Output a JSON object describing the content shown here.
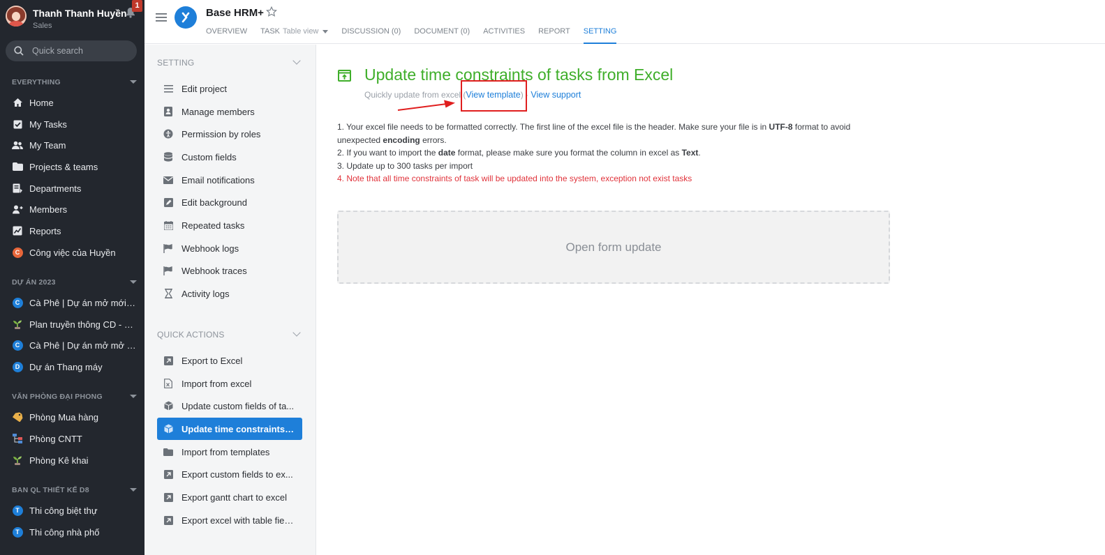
{
  "user": {
    "name": "Thanh Thanh Huyền",
    "role": "Sales",
    "notification_count": "1"
  },
  "search": {
    "placeholder": "Quick search"
  },
  "sidebar": {
    "groups": [
      {
        "title": "EVERYTHING",
        "items": [
          {
            "label": "Home",
            "icon": "home-icon"
          },
          {
            "label": "My Tasks",
            "icon": "task-check-icon"
          },
          {
            "label": "My Team",
            "icon": "team-icon"
          },
          {
            "label": "Projects & teams",
            "icon": "folder-icon"
          },
          {
            "label": "Departments",
            "icon": "departments-icon"
          },
          {
            "label": "Members",
            "icon": "members-icon"
          },
          {
            "label": "Reports",
            "icon": "reports-chart-icon"
          },
          {
            "label": "Công việc của Huyền",
            "badge": "C",
            "color": "#e8663a"
          }
        ]
      },
      {
        "title": "DỰ ÁN 2023",
        "items": [
          {
            "label": "Cà Phê | Dự án mở mới c...",
            "badge": "C",
            "color": "#1e7fd9"
          },
          {
            "label": "Plan truyền thông CD - M...",
            "icon": "plant-icon"
          },
          {
            "label": "Cà Phê | Dự án mở mở V...",
            "badge": "C",
            "color": "#1e7fd9"
          },
          {
            "label": "Dự án Thang máy",
            "badge": "D",
            "color": "#1e7fd9"
          }
        ]
      },
      {
        "title": "VĂN PHÒNG ĐẠI PHONG",
        "items": [
          {
            "label": "Phòng Mua hàng",
            "icon": "tag-icon"
          },
          {
            "label": "Phòng CNTT",
            "icon": "hierarchy-icon"
          },
          {
            "label": "Phòng Kê khai",
            "icon": "plant-icon"
          }
        ]
      },
      {
        "title": "BAN QL THIẾT KẾ D8",
        "items": [
          {
            "label": "Thi công biệt thự",
            "badge": "T",
            "color": "#1e7fd9"
          },
          {
            "label": "Thi công nhà phố",
            "badge": "T",
            "color": "#1e7fd9"
          }
        ]
      }
    ]
  },
  "header": {
    "project_title": "Base HRM+",
    "tabs": [
      {
        "label": "OVERVIEW"
      },
      {
        "label": "TASK",
        "sub": "Table view"
      },
      {
        "label": "DISCUSSION (0)"
      },
      {
        "label": "DOCUMENT (0)"
      },
      {
        "label": "ACTIVITIES"
      },
      {
        "label": "REPORT"
      },
      {
        "label": "SETTING",
        "active": true
      }
    ]
  },
  "settings_menu": {
    "setting_title": "SETTING",
    "setting_items": [
      {
        "label": "Edit project",
        "icon": "list-icon"
      },
      {
        "label": "Manage members",
        "icon": "member-card-icon"
      },
      {
        "label": "Permission by roles",
        "icon": "accessibility-icon"
      },
      {
        "label": "Custom fields",
        "icon": "database-icon"
      },
      {
        "label": "Email notifications",
        "icon": "envelope-icon"
      },
      {
        "label": "Edit background",
        "icon": "edit-icon"
      },
      {
        "label": "Repeated tasks",
        "icon": "calendar-icon"
      },
      {
        "label": "Webhook logs",
        "icon": "flag-icon"
      },
      {
        "label": "Webhook traces",
        "icon": "flag-icon"
      },
      {
        "label": "Activity logs",
        "icon": "hourglass-icon"
      }
    ],
    "quick_title": "QUICK ACTIONS",
    "quick_items": [
      {
        "label": "Export to Excel",
        "icon": "export-icon"
      },
      {
        "label": "Import from excel",
        "icon": "excel-file-icon"
      },
      {
        "label": "Update custom fields of ta...",
        "icon": "cube-icon"
      },
      {
        "label": "Update time constraints of...",
        "icon": "cube-icon",
        "active": true
      },
      {
        "label": "Import from templates",
        "icon": "folder-icon"
      },
      {
        "label": "Export custom fields to ex...",
        "icon": "export-icon"
      },
      {
        "label": "Export gantt chart to excel",
        "icon": "export-icon"
      },
      {
        "label": "Export excel with table fields",
        "icon": "export-icon"
      }
    ]
  },
  "main": {
    "title": "Update time constraints of tasks from Excel",
    "subtitle_prefix": "Quickly update from excel (",
    "view_template": "View template",
    "subtitle_mid": ") · ",
    "view_support": "View support",
    "instructions": {
      "line1_a": "1. Your excel file needs to be formatted correctly. The first line of the excel file is the header. Make sure your file is in ",
      "line1_b": "UTF-8",
      "line1_c": " format to avoid unexpected ",
      "line1_d": "encoding",
      "line1_e": " errors.",
      "line2_a": "2. If you want to import the ",
      "line2_b": "date",
      "line2_c": " format, please make sure you format the column in excel as ",
      "line2_d": "Text",
      "line2_e": ".",
      "line3": "3. Update up to 300 tasks per import",
      "line4": "4. Note that all time constraints of task will be updated into the system, exception not exist tasks"
    },
    "upload_label": "Open form update"
  },
  "colors": {
    "accent": "#1e7fd9",
    "title_green": "#3fae2a",
    "warning_red": "#e0323a",
    "sidebar_bg": "#23272e"
  }
}
